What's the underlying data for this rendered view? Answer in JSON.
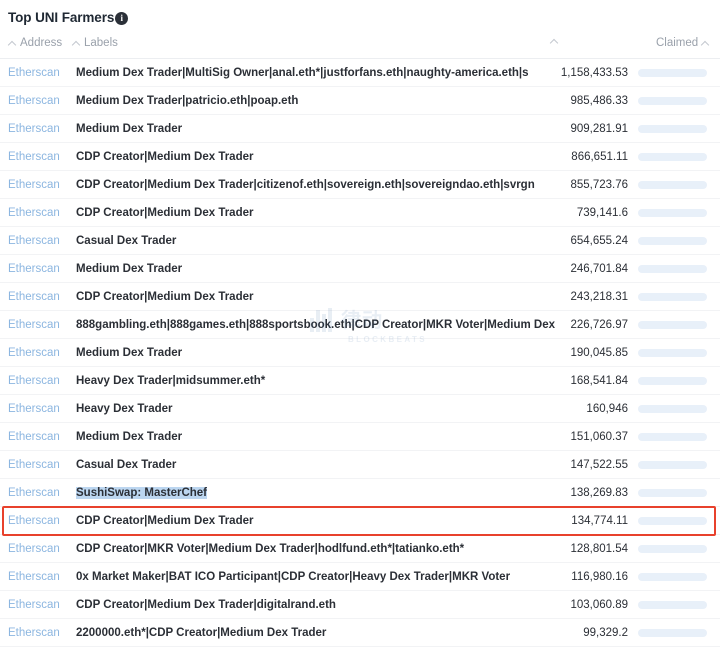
{
  "header": {
    "title": "Top UNI Farmers",
    "info_icon": "info-icon",
    "info_glyph": "i"
  },
  "columns": {
    "address": "Address",
    "labels": "Labels",
    "value": "",
    "claimed": "Claimed",
    "sort_icon": "caret-up-icon"
  },
  "colors": {
    "bar_fill": "#649fd8",
    "bar_track": "#e8f0f9",
    "link": "#8cb6e0",
    "highlight_border": "#e8412c",
    "selection": "#bcd6f0"
  },
  "highlight": {
    "row_index": 16,
    "border_color": "#e8412c"
  },
  "watermark": {
    "cn": "律动",
    "en": "BLOCKBEATS"
  },
  "max_value": 1158433.53,
  "rows": [
    {
      "address": "Etherscan",
      "labels": "Medium Dex Trader|MultiSig Owner|anal.eth*|justforfans.eth|naughty-america.eth|s",
      "value": "1,158,433.53",
      "num": 1158433.53,
      "selected": false
    },
    {
      "address": "Etherscan",
      "labels": "Medium Dex Trader|patricio.eth|poap.eth",
      "value": "985,486.33",
      "num": 985486.33,
      "selected": false
    },
    {
      "address": "Etherscan",
      "labels": "Medium Dex Trader",
      "value": "909,281.91",
      "num": 909281.91,
      "selected": false
    },
    {
      "address": "Etherscan",
      "labels": "CDP Creator|Medium Dex Trader",
      "value": "866,651.11",
      "num": 866651.11,
      "selected": false
    },
    {
      "address": "Etherscan",
      "labels": "CDP Creator|Medium Dex Trader|citizenof.eth|sovereign.eth|sovereigndao.eth|svrgn",
      "value": "855,723.76",
      "num": 855723.76,
      "selected": false
    },
    {
      "address": "Etherscan",
      "labels": "CDP Creator|Medium Dex Trader",
      "value": "739,141.6",
      "num": 739141.6,
      "selected": false
    },
    {
      "address": "Etherscan",
      "labels": "Casual Dex Trader",
      "value": "654,655.24",
      "num": 654655.24,
      "selected": false
    },
    {
      "address": "Etherscan",
      "labels": "Medium Dex Trader",
      "value": "246,701.84",
      "num": 246701.84,
      "selected": false
    },
    {
      "address": "Etherscan",
      "labels": "CDP Creator|Medium Dex Trader",
      "value": "243,218.31",
      "num": 243218.31,
      "selected": false
    },
    {
      "address": "Etherscan",
      "labels": "888gambling.eth|888games.eth|888sportsbook.eth|CDP Creator|MKR Voter|Medium Dex",
      "value": "226,726.97",
      "num": 226726.97,
      "selected": false
    },
    {
      "address": "Etherscan",
      "labels": "Medium Dex Trader",
      "value": "190,045.85",
      "num": 190045.85,
      "selected": false
    },
    {
      "address": "Etherscan",
      "labels": "Heavy Dex Trader|midsummer.eth*",
      "value": "168,541.84",
      "num": 168541.84,
      "selected": false
    },
    {
      "address": "Etherscan",
      "labels": "Heavy Dex Trader",
      "value": "160,946",
      "num": 160946,
      "selected": false
    },
    {
      "address": "Etherscan",
      "labels": "Medium Dex Trader",
      "value": "151,060.37",
      "num": 151060.37,
      "selected": false
    },
    {
      "address": "Etherscan",
      "labels": "Casual Dex Trader",
      "value": "147,522.55",
      "num": 147522.55,
      "selected": false
    },
    {
      "address": "Etherscan",
      "labels": "SushiSwap: MasterChef",
      "value": "138,269.83",
      "num": 138269.83,
      "selected": true
    },
    {
      "address": "Etherscan",
      "labels": "CDP Creator|Medium Dex Trader",
      "value": "134,774.11",
      "num": 134774.11,
      "selected": false
    },
    {
      "address": "Etherscan",
      "labels": "CDP Creator|MKR Voter|Medium Dex Trader|hodlfund.eth*|tatianko.eth*",
      "value": "128,801.54",
      "num": 128801.54,
      "selected": false
    },
    {
      "address": "Etherscan",
      "labels": "0x Market Maker|BAT ICO Participant|CDP Creator|Heavy Dex Trader|MKR Voter",
      "value": "116,980.16",
      "num": 116980.16,
      "selected": false
    },
    {
      "address": "Etherscan",
      "labels": "CDP Creator|Medium Dex Trader|digitalrand.eth",
      "value": "103,060.89",
      "num": 103060.89,
      "selected": false
    },
    {
      "address": "Etherscan",
      "labels": "2200000.eth*|CDP Creator|Medium Dex Trader",
      "value": "99,329.2",
      "num": 99329.2,
      "selected": false
    }
  ]
}
